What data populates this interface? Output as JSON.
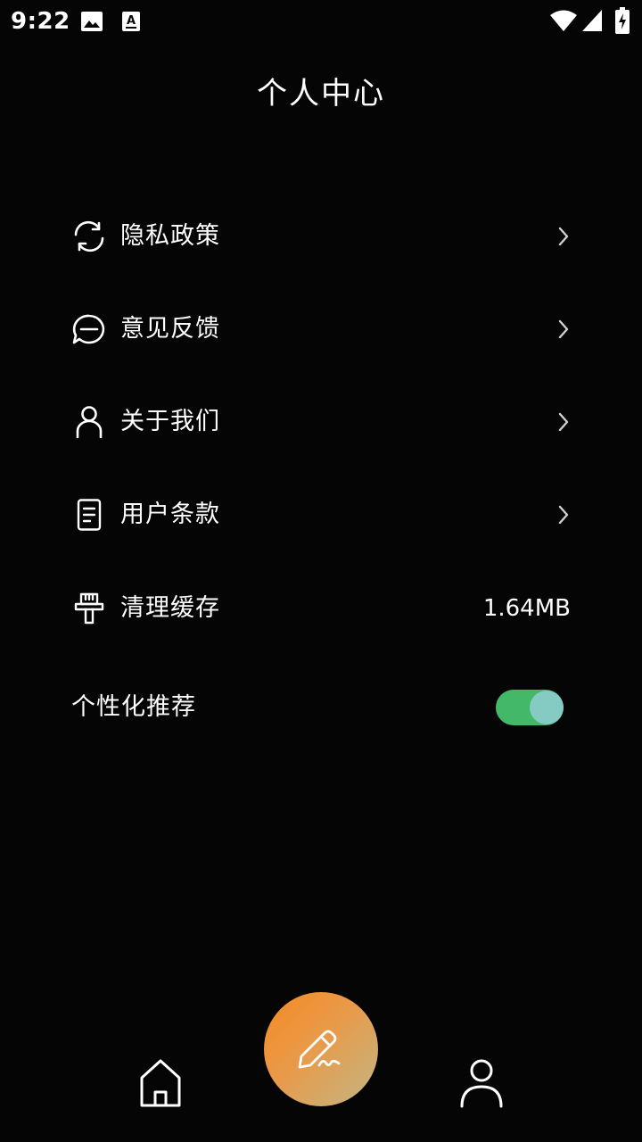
{
  "status_bar": {
    "time": "9:22",
    "icons": [
      "image-icon",
      "a-notification-icon",
      "wifi-icon",
      "signal-icon",
      "battery-charging-icon"
    ]
  },
  "header": {
    "title": "个人中心"
  },
  "menu": {
    "items": [
      {
        "label": "隐私政策",
        "icon": "refresh-icon",
        "trailing": "chevron"
      },
      {
        "label": "意见反馈",
        "icon": "chat-bubble-icon",
        "trailing": "chevron"
      },
      {
        "label": "关于我们",
        "icon": "user-icon",
        "trailing": "chevron"
      },
      {
        "label": "用户条款",
        "icon": "document-icon",
        "trailing": "chevron"
      },
      {
        "label": "清理缓存",
        "icon": "brush-icon",
        "trailing": "value",
        "value": "1.64MB"
      }
    ],
    "personalized": {
      "label": "个性化推荐",
      "enabled": true
    }
  },
  "bottom_nav": {
    "items": [
      "home-icon",
      "edit-pen-icon",
      "profile-icon"
    ]
  },
  "colors": {
    "background": "#050505",
    "toggle_track": "#43b868",
    "toggle_knob": "#86cac4",
    "fab_gradient_start": "#f68a22",
    "fab_gradient_end": "#c3b684"
  }
}
